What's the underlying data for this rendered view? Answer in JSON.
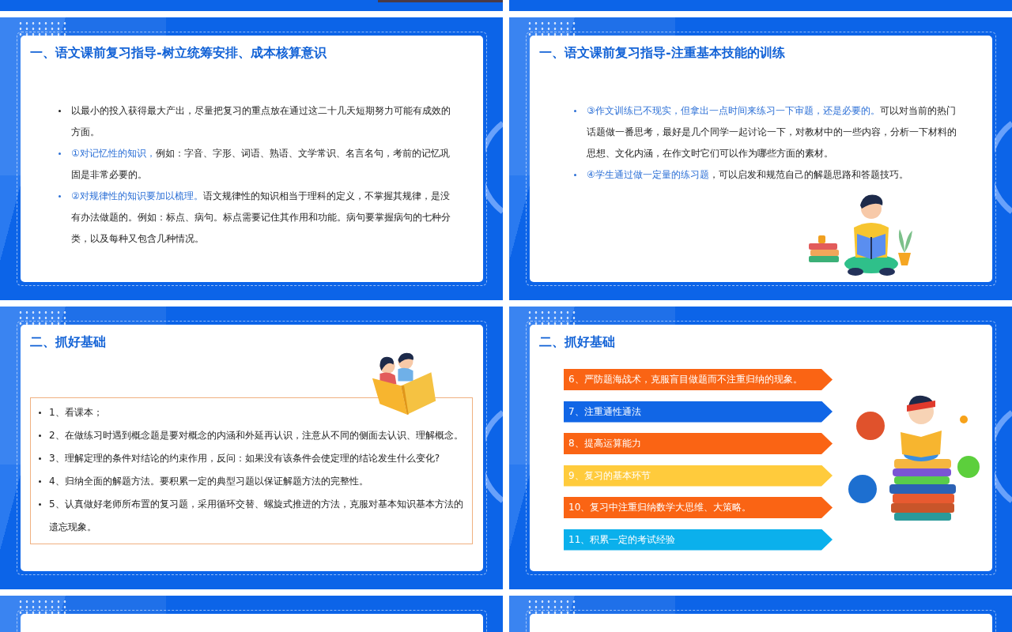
{
  "slides": [
    {
      "kind": "bullets",
      "title": "一、语文课前复习指导-树立统筹安排、成本核算意识",
      "items": [
        {
          "text": "以最小的投入获得最大产出，尽量把复习的重点放在通过这二十几天短期努力可能有成效的方面。"
        },
        {
          "lead": "①对记忆性的知识，",
          "text": "例如：字音、字形、词语、熟语、文学常识、名言名句，考前的记忆巩固是非常必要的。"
        },
        {
          "lead": "②对规律性的知识要加以梳理。",
          "text": "语文规律性的知识相当于理科的定义，不掌握其规律，是没有办法做题的。例如：标点、病句。标点需要记住其作用和功能。病句要掌握病句的七种分类，以及每种又包含几种情况。"
        }
      ]
    },
    {
      "kind": "illustrated_bullets",
      "title": "一、语文课前复习指导-注重基本技能的训练",
      "items": [
        {
          "lead": "③作文训练已不现实，但拿出一点时间来练习一下审题，还是必要的。",
          "text": "可以对当前的热门话题做一番思考，最好是几个同学一起讨论一下，对教材中的一些内容，分析一下材料的思想、文化内涵，在作文时它们可以作为哪些方面的素材。"
        },
        {
          "lead": "④学生通过做一定量的练习题",
          "text": "，可以启发和规范自己的解题思路和答题技巧。"
        }
      ]
    },
    {
      "kind": "boxed",
      "title": "二、抓好基础",
      "items": [
        "1、看课本；",
        "2、在做练习时遇到概念题是要对概念的内涵和外延再认识，注意从不同的侧面去认识、理解概念。",
        "3、理解定理的条件对结论的约束作用，反问：如果没有该条件会使定理的结论发生什么变化?",
        "4、归纳全面的解题方法。要积累一定的典型习题以保证解题方法的完整性。",
        "5、认真做好老师所布置的复习题，采用循环交替、螺旋式推进的方法，克服对基本知识基本方法的遗忘现象。"
      ]
    },
    {
      "kind": "arrows",
      "title": "二、抓好基础",
      "items": [
        {
          "text": "6、严防题海战术，克服盲目做题而不注重归纳的现象。",
          "color": "#fa6414"
        },
        {
          "text": "7、注重通性通法",
          "color": "#1166e6"
        },
        {
          "text": "8、提高运算能力",
          "color": "#fa6414"
        },
        {
          "text": "9、复习的基本环节",
          "color": "#ffcb3c"
        },
        {
          "text": "10、复习中注重归纳数学大思维、大策略。",
          "color": "#fa6414"
        },
        {
          "text": "11、积累一定的考试经验",
          "color": "#0bb0ec"
        }
      ]
    },
    {
      "kind": "blank"
    },
    {
      "kind": "blank"
    }
  ]
}
